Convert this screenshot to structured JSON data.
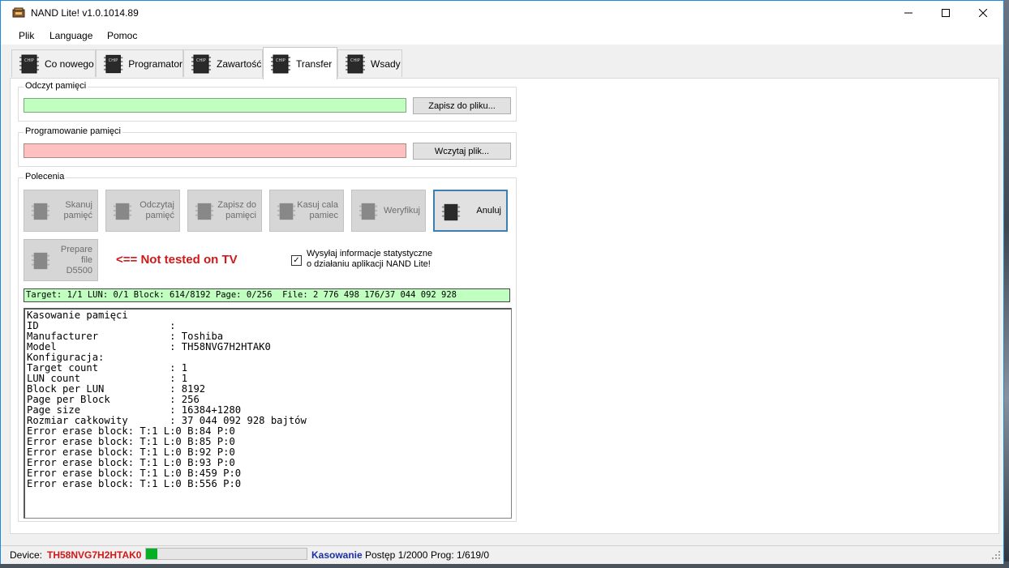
{
  "window": {
    "title": "NAND Lite! v1.0.1014.89"
  },
  "menu": [
    "Plik",
    "Language",
    "Pomoc"
  ],
  "tabs": [
    {
      "label": "Co nowego"
    },
    {
      "label": "Programator"
    },
    {
      "label": "Zawartość"
    },
    {
      "label": "Transfer"
    },
    {
      "label": "Wsady"
    }
  ],
  "active_tab": "Transfer",
  "read_group": {
    "title": "Odczyt pamięci",
    "button": "Zapisz do pliku..."
  },
  "program_group": {
    "title": "Programowanie pamięci",
    "button": "Wczytaj plik..."
  },
  "commands": {
    "title": "Polecenia",
    "buttons": [
      {
        "label": "Skanuj\npamięć"
      },
      {
        "label": "Odczytaj\npamięć"
      },
      {
        "label": "Zapisz do\npamięci"
      },
      {
        "label": "Kasuj cala\npamiec"
      },
      {
        "label": "Weryfikuj"
      },
      {
        "label": "Anuluj"
      },
      {
        "label": "Prepare\nfile\nD5500"
      }
    ],
    "warning": "<== Not tested on TV",
    "stats_checkbox": {
      "checked": true,
      "mark": "✓",
      "label": "Wysyłaj informacje statystyczne\no działaniu aplikacji NAND Lite!"
    }
  },
  "status_line": "Target: 1/1 LUN: 0/1 Block: 614/8192 Page: 0/256  File: 2 776 498 176/37 044 092 928",
  "log": [
    "Kasowanie pamięci",
    "ID                      :",
    "Manufacturer            : Toshiba",
    "Model                   : TH58NVG7H2HTAK0",
    "Konfiguracja:",
    "Target count            : 1",
    "LUN count               : 1",
    "Block per LUN           : 8192",
    "Page per Block          : 256",
    "Page size               : 16384+1280",
    "Rozmiar całkowity       : 37 044 092 928 bajtów",
    "Error erase block: T:1 L:0 B:84 P:0",
    "Error erase block: T:1 L:0 B:85 P:0",
    "Error erase block: T:1 L:0 B:92 P:0",
    "Error erase block: T:1 L:0 B:93 P:0",
    "Error erase block: T:1 L:0 B:459 P:0",
    "Error erase block: T:1 L:0 B:556 P:0"
  ],
  "statusbar": {
    "device_label": "Device:",
    "device_value": "TH58NVG7H2HTAK0",
    "progress_fraction": 0.07,
    "operation": "Kasowanie",
    "postep": "Postęp 1/2000",
    "prog": "Prog: 1/619/0"
  },
  "colors": {
    "read_bar": "#c0ffc0",
    "program_bar": "#ffc0c0",
    "device": "#d01818",
    "operation": "#1a2fa8",
    "progress": "#06b025"
  },
  "icons": [
    "app-icon",
    "chip-icon",
    "minimize-icon",
    "maximize-icon",
    "close-icon",
    "resize-grip-icon"
  ]
}
